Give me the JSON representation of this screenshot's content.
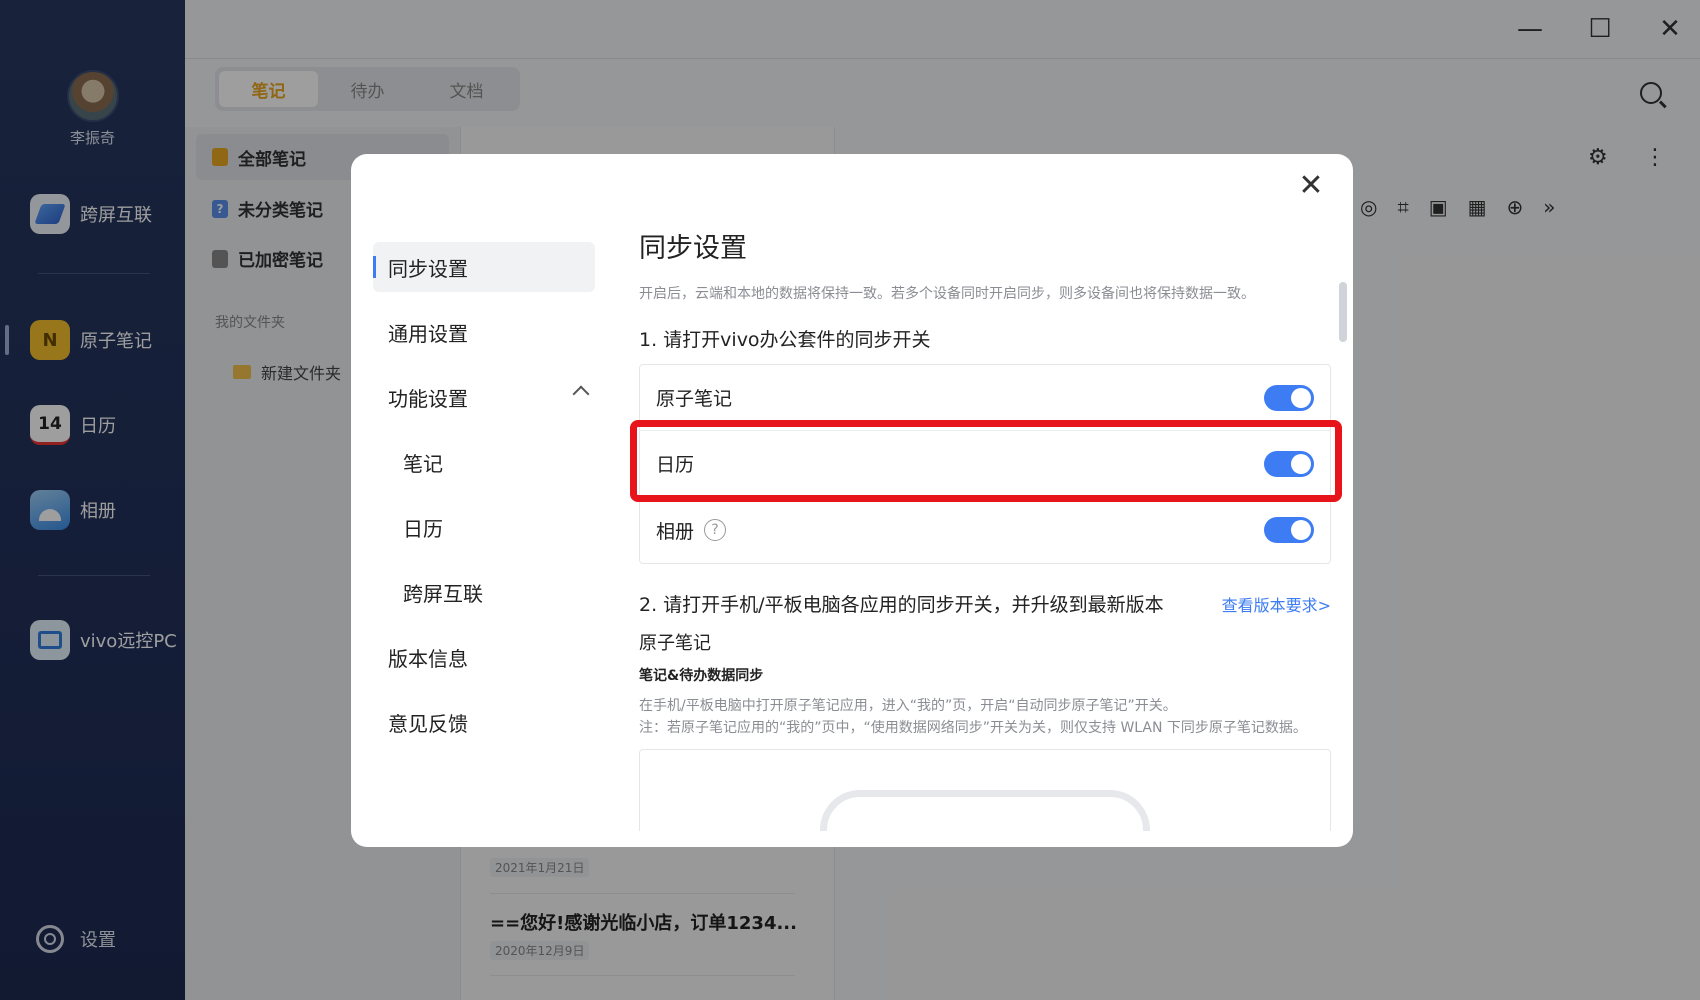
{
  "rail": {
    "username": "李振奇",
    "items": [
      {
        "label": "跨屏互联",
        "icon": "cross-screen-icon"
      },
      {
        "label": "原子笔记",
        "icon": "atom-notes-icon"
      },
      {
        "label": "日历",
        "icon": "calendar-icon",
        "icon_text": "14"
      },
      {
        "label": "相册",
        "icon": "album-icon"
      },
      {
        "label": "vivo远控PC",
        "icon": "remote-pc-icon"
      }
    ],
    "settings_label": "设置"
  },
  "window": {
    "minimize": "—",
    "maximize": "☐",
    "close": "✕"
  },
  "bg": {
    "tabs": [
      "笔记",
      "待办",
      "文档"
    ],
    "folders": [
      "全部笔记",
      "未分类笔记",
      "已加密笔记"
    ],
    "my_folders": "我的文件夹",
    "new_folder": "新建文件夹",
    "notes": [
      {
        "date": "2021年1月21日"
      },
      {
        "title": "==您好!感谢光临小店，订单1234...",
        "date": "2020年12月9日"
      }
    ],
    "colors": {
      "accent": "#e8a623",
      "rail": "#22305a"
    }
  },
  "modal": {
    "close": "✕",
    "sidebar": [
      {
        "label": "同步设置",
        "active": true
      },
      {
        "label": "通用设置"
      },
      {
        "label": "功能设置",
        "expanded": true
      },
      {
        "label": "笔记",
        "sub": true
      },
      {
        "label": "日历",
        "sub": true
      },
      {
        "label": "跨屏互联",
        "sub": true
      },
      {
        "label": "版本信息"
      },
      {
        "label": "意见反馈"
      }
    ],
    "title": "同步设置",
    "description": "开启后，云端和本地的数据将保持一致。若多个设备同时开启同步，则多设备间也将保持数据一致。",
    "step1": "1. 请打开vivo办公套件的同步开关",
    "toggles": [
      {
        "label": "原子笔记",
        "on": true
      },
      {
        "label": "日历",
        "on": true
      },
      {
        "label": "相册",
        "on": true,
        "help": "?"
      }
    ],
    "step2": "2. 请打开手机/平板电脑各应用的同步开关，并升级到最新版本",
    "step2_link": "查看版本要求>",
    "app_name": "原子笔记",
    "sub_title": "笔记&待办数据同步",
    "note_line1": "在手机/平板电脑中打开原子笔记应用，进入“我的”页，开启“自动同步原子笔记”开关。",
    "note_line2": "注：若原子笔记应用的“我的”页中，“使用数据网络同步”开关为关，则仅支持 WLAN 下同步原子笔记数据。",
    "accent": "#3d7cf2"
  }
}
